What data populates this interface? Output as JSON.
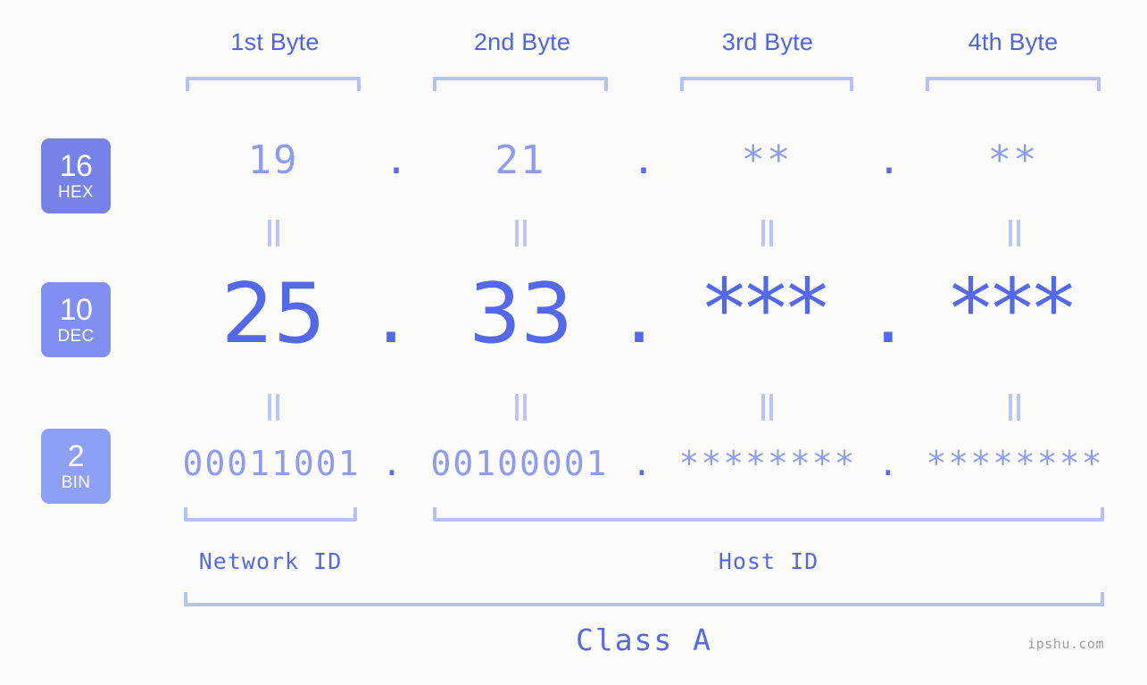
{
  "meta": {
    "background": "#fcfdfa",
    "accent": "#5468ec",
    "accent_light": "#8e9bf3",
    "bracket_color": "#b6c0fb"
  },
  "byte_headers": [
    {
      "label": "1st Byte"
    },
    {
      "label": "2nd Byte"
    },
    {
      "label": "3rd Byte"
    },
    {
      "label": "4th Byte"
    }
  ],
  "radix_badges": [
    {
      "number": "16",
      "name": "HEX",
      "color": "#7782e9"
    },
    {
      "number": "10",
      "name": "DEC",
      "color": "#818ef2"
    },
    {
      "number": "2",
      "name": "BIN",
      "color": "#8ea0f6"
    }
  ],
  "rows": {
    "hex": {
      "values": [
        "19",
        "21",
        "**",
        "**"
      ],
      "separators": [
        ".",
        ".",
        "."
      ]
    },
    "dec": {
      "values": [
        "25",
        "33",
        "***",
        "***"
      ],
      "separators": [
        ".",
        ".",
        "."
      ]
    },
    "bin": {
      "values": [
        "00011001",
        "00100001",
        "********",
        "********"
      ],
      "separators": [
        ".",
        ".",
        "."
      ]
    }
  },
  "equality_marks": {
    "symbol": "||",
    "count_per_row": 4
  },
  "sections": [
    {
      "label": "Network ID"
    },
    {
      "label": "Host ID"
    }
  ],
  "class": {
    "label": "Class A"
  },
  "watermark": {
    "text": "ipshu.com"
  }
}
